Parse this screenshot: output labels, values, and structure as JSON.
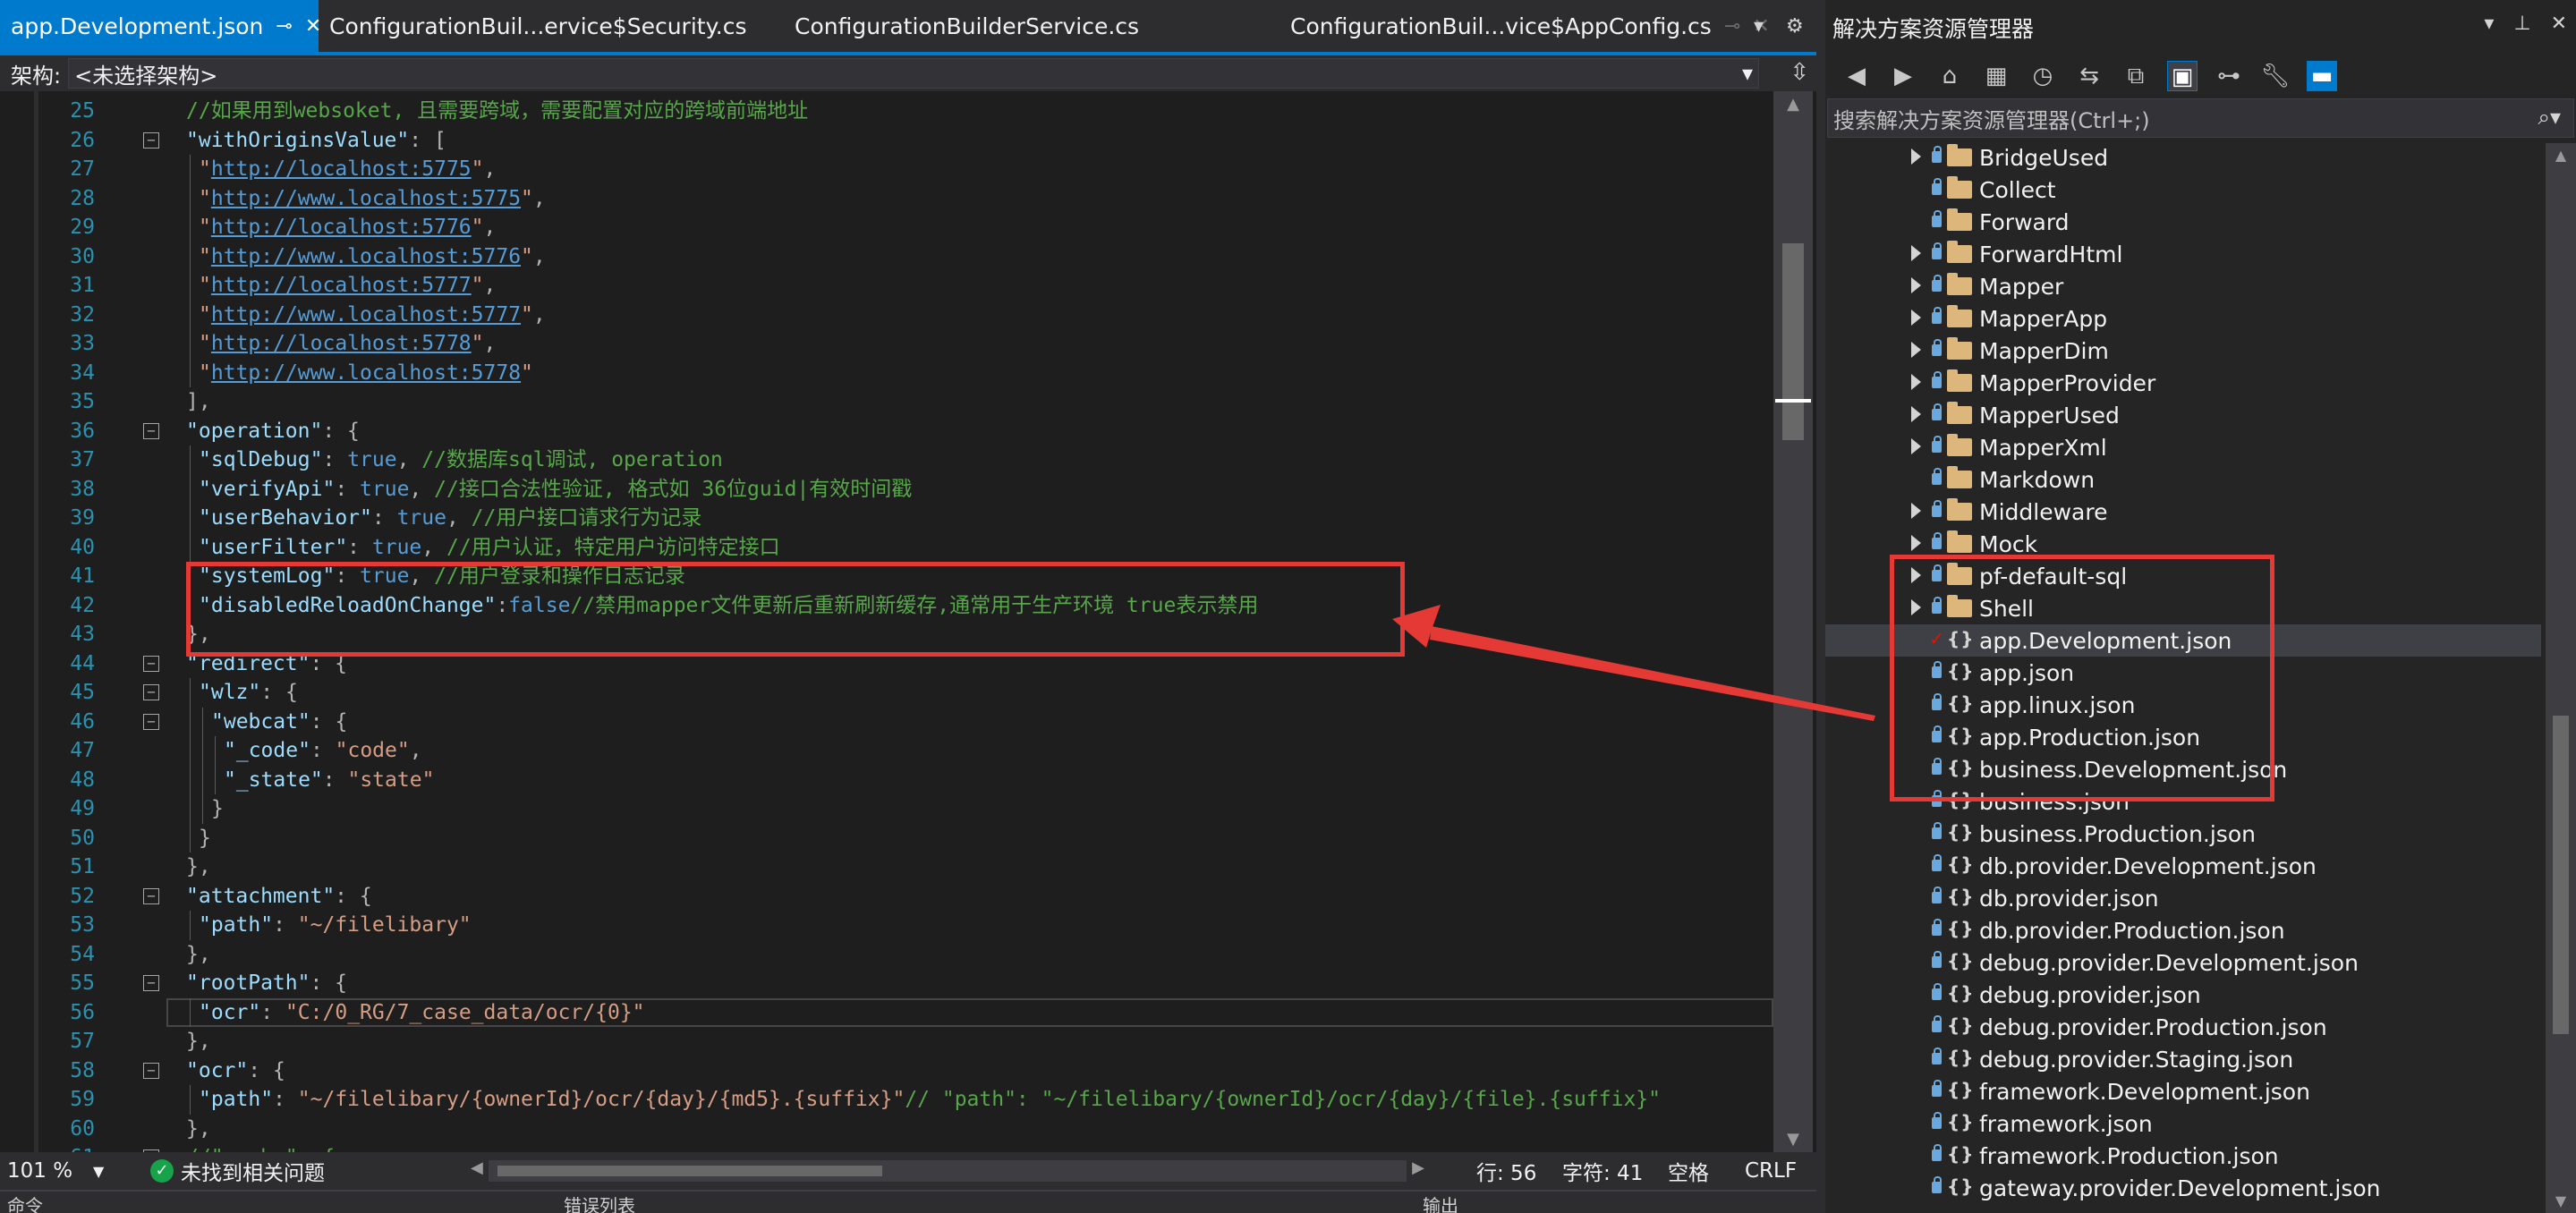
{
  "editor": {
    "tabs": [
      {
        "label": "app.Development.json",
        "active": true,
        "pin_icon": "pin-icon",
        "close_icon": "close-icon"
      },
      {
        "label": "ConfigurationBuil...ervice$Security.cs",
        "active": false
      },
      {
        "label": "ConfigurationBuilderService.cs",
        "active": false
      },
      {
        "label": "ConfigurationBuil...vice$AppConfig.cs",
        "active": false
      }
    ],
    "nav": {
      "label": "架构:",
      "value": "<未选择架构>"
    },
    "lines": [
      {
        "n": "25",
        "indent": 1,
        "html_parts": [
          {
            "c": "cm",
            "t": "//如果用到websoket, 且需要跨域，需要配置对应的跨域前端地址"
          }
        ]
      },
      {
        "n": "26",
        "indent": 1,
        "fold": "-",
        "html_parts": [
          {
            "c": "key",
            "t": "\"withOriginsValue\""
          },
          {
            "c": "p",
            "t": ": ["
          }
        ]
      },
      {
        "n": "27",
        "indent": 2,
        "html_parts": [
          {
            "c": "q",
            "t": "\""
          },
          {
            "c": "url",
            "t": "http://localhost:5775"
          },
          {
            "c": "q",
            "t": "\""
          },
          {
            "c": "p",
            "t": ","
          }
        ]
      },
      {
        "n": "28",
        "indent": 2,
        "html_parts": [
          {
            "c": "q",
            "t": "\""
          },
          {
            "c": "url",
            "t": "http://www.localhost:5775"
          },
          {
            "c": "q",
            "t": "\""
          },
          {
            "c": "p",
            "t": ","
          }
        ]
      },
      {
        "n": "29",
        "indent": 2,
        "html_parts": [
          {
            "c": "q",
            "t": "\""
          },
          {
            "c": "url",
            "t": "http://localhost:5776"
          },
          {
            "c": "q",
            "t": "\""
          },
          {
            "c": "p",
            "t": ","
          }
        ]
      },
      {
        "n": "30",
        "indent": 2,
        "html_parts": [
          {
            "c": "q",
            "t": "\""
          },
          {
            "c": "url",
            "t": "http://www.localhost:5776"
          },
          {
            "c": "q",
            "t": "\""
          },
          {
            "c": "p",
            "t": ","
          }
        ]
      },
      {
        "n": "31",
        "indent": 2,
        "html_parts": [
          {
            "c": "q",
            "t": "\""
          },
          {
            "c": "url",
            "t": "http://localhost:5777"
          },
          {
            "c": "q",
            "t": "\""
          },
          {
            "c": "p",
            "t": ","
          }
        ]
      },
      {
        "n": "32",
        "indent": 2,
        "html_parts": [
          {
            "c": "q",
            "t": "\""
          },
          {
            "c": "url",
            "t": "http://www.localhost:5777"
          },
          {
            "c": "q",
            "t": "\""
          },
          {
            "c": "p",
            "t": ","
          }
        ]
      },
      {
        "n": "33",
        "indent": 2,
        "html_parts": [
          {
            "c": "q",
            "t": "\""
          },
          {
            "c": "url",
            "t": "http://localhost:5778"
          },
          {
            "c": "q",
            "t": "\""
          },
          {
            "c": "p",
            "t": ","
          }
        ]
      },
      {
        "n": "34",
        "indent": 2,
        "html_parts": [
          {
            "c": "q",
            "t": "\""
          },
          {
            "c": "url",
            "t": "http://www.localhost:5778"
          },
          {
            "c": "q",
            "t": "\""
          }
        ]
      },
      {
        "n": "35",
        "indent": 1,
        "html_parts": [
          {
            "c": "p",
            "t": "],"
          }
        ]
      },
      {
        "n": "36",
        "indent": 1,
        "fold": "-",
        "html_parts": [
          {
            "c": "key",
            "t": "\"operation\""
          },
          {
            "c": "p",
            "t": ": {"
          }
        ]
      },
      {
        "n": "37",
        "indent": 2,
        "html_parts": [
          {
            "c": "key",
            "t": "\"sqlDebug\""
          },
          {
            "c": "p",
            "t": ": "
          },
          {
            "c": "kw",
            "t": "true"
          },
          {
            "c": "p",
            "t": ", "
          },
          {
            "c": "cm",
            "t": "//数据库sql调试, operation"
          }
        ]
      },
      {
        "n": "38",
        "indent": 2,
        "html_parts": [
          {
            "c": "key",
            "t": "\"verifyApi\""
          },
          {
            "c": "p",
            "t": ": "
          },
          {
            "c": "kw",
            "t": "true"
          },
          {
            "c": "p",
            "t": ", "
          },
          {
            "c": "cm",
            "t": "//接口合法性验证, 格式如 36位guid|有效时间戳"
          }
        ]
      },
      {
        "n": "39",
        "indent": 2,
        "html_parts": [
          {
            "c": "key",
            "t": "\"userBehavior\""
          },
          {
            "c": "p",
            "t": ": "
          },
          {
            "c": "kw",
            "t": "true"
          },
          {
            "c": "p",
            "t": ", "
          },
          {
            "c": "cm",
            "t": "//用户接口请求行为记录"
          }
        ]
      },
      {
        "n": "40",
        "indent": 2,
        "html_parts": [
          {
            "c": "key",
            "t": "\"userFilter\""
          },
          {
            "c": "p",
            "t": ": "
          },
          {
            "c": "kw",
            "t": "true"
          },
          {
            "c": "p",
            "t": ", "
          },
          {
            "c": "cm",
            "t": "//用户认证，特定用户访问特定接口"
          }
        ]
      },
      {
        "n": "41",
        "indent": 2,
        "html_parts": [
          {
            "c": "key",
            "t": "\"systemLog\""
          },
          {
            "c": "p",
            "t": ": "
          },
          {
            "c": "kw",
            "t": "true"
          },
          {
            "c": "p",
            "t": ", "
          },
          {
            "c": "cm",
            "t": "//用户登录和操作日志记录"
          }
        ]
      },
      {
        "n": "42",
        "indent": 2,
        "html_parts": [
          {
            "c": "key",
            "t": "\"disabledReloadOnChange\""
          },
          {
            "c": "p",
            "t": ":"
          },
          {
            "c": "kw",
            "t": "false"
          },
          {
            "c": "cm",
            "t": "//禁用mapper文件更新后重新刷新缓存,通常用于生产环境 true表示禁用"
          }
        ]
      },
      {
        "n": "43",
        "indent": 1,
        "html_parts": [
          {
            "c": "p",
            "t": "},"
          }
        ]
      },
      {
        "n": "44",
        "indent": 1,
        "fold": "-",
        "html_parts": [
          {
            "c": "key",
            "t": "\"redirect\""
          },
          {
            "c": "p",
            "t": ": {"
          }
        ]
      },
      {
        "n": "45",
        "indent": 2,
        "fold": "-",
        "html_parts": [
          {
            "c": "key",
            "t": "\"wlz\""
          },
          {
            "c": "p",
            "t": ": {"
          }
        ]
      },
      {
        "n": "46",
        "indent": 3,
        "fold": "-",
        "html_parts": [
          {
            "c": "key",
            "t": "\"webcat\""
          },
          {
            "c": "p",
            "t": ": {"
          }
        ]
      },
      {
        "n": "47",
        "indent": 4,
        "html_parts": [
          {
            "c": "key",
            "t": "\"_code\""
          },
          {
            "c": "p",
            "t": ": "
          },
          {
            "c": "str",
            "t": "\"code\""
          },
          {
            "c": "p",
            "t": ","
          }
        ]
      },
      {
        "n": "48",
        "indent": 4,
        "html_parts": [
          {
            "c": "key",
            "t": "\"_state\""
          },
          {
            "c": "p",
            "t": ": "
          },
          {
            "c": "str",
            "t": "\"state\""
          }
        ]
      },
      {
        "n": "49",
        "indent": 3,
        "html_parts": [
          {
            "c": "p",
            "t": "}"
          }
        ]
      },
      {
        "n": "50",
        "indent": 2,
        "html_parts": [
          {
            "c": "p",
            "t": "}"
          }
        ]
      },
      {
        "n": "51",
        "indent": 1,
        "html_parts": [
          {
            "c": "p",
            "t": "},"
          }
        ]
      },
      {
        "n": "52",
        "indent": 1,
        "fold": "-",
        "html_parts": [
          {
            "c": "key",
            "t": "\"attachment\""
          },
          {
            "c": "p",
            "t": ": {"
          }
        ]
      },
      {
        "n": "53",
        "indent": 2,
        "html_parts": [
          {
            "c": "key",
            "t": "\"path\""
          },
          {
            "c": "p",
            "t": ": "
          },
          {
            "c": "str",
            "t": "\"~/filelibary\""
          }
        ]
      },
      {
        "n": "54",
        "indent": 1,
        "html_parts": [
          {
            "c": "p",
            "t": "},"
          }
        ]
      },
      {
        "n": "55",
        "indent": 1,
        "fold": "-",
        "html_parts": [
          {
            "c": "key",
            "t": "\"rootPath\""
          },
          {
            "c": "p",
            "t": ": {"
          }
        ]
      },
      {
        "n": "56",
        "indent": 2,
        "current": true,
        "html_parts": [
          {
            "c": "key",
            "t": "\"ocr\""
          },
          {
            "c": "p",
            "t": ": "
          },
          {
            "c": "str",
            "t": "\"C:/0_RG/7_case_data/ocr/{0}\""
          }
        ]
      },
      {
        "n": "57",
        "indent": 1,
        "html_parts": [
          {
            "c": "p",
            "t": "},"
          }
        ]
      },
      {
        "n": "58",
        "indent": 1,
        "fold": "-",
        "html_parts": [
          {
            "c": "key",
            "t": "\"ocr\""
          },
          {
            "c": "p",
            "t": ": {"
          }
        ]
      },
      {
        "n": "59",
        "indent": 2,
        "html_parts": [
          {
            "c": "key",
            "t": "\"path\""
          },
          {
            "c": "p",
            "t": ": "
          },
          {
            "c": "str",
            "t": "\"~/filelibary/{ownerId}/ocr/{day}/{md5}.{suffix}\""
          },
          {
            "c": "cm",
            "t": "// \"path\": \"~/filelibary/{ownerId}/ocr/{day}/{file}.{suffix}\""
          }
        ]
      },
      {
        "n": "60",
        "indent": 1,
        "html_parts": [
          {
            "c": "p",
            "t": "},"
          }
        ]
      },
      {
        "n": "61",
        "indent": 1,
        "fold": "-",
        "html_parts": [
          {
            "c": "cm",
            "t": "//\"cache\": {"
          }
        ]
      }
    ],
    "status": {
      "zoom": "101 %",
      "issues": "未找到相关问题",
      "line": "行: 56",
      "char": "字符: 41",
      "whitespace": "空格",
      "eol": "CRLF"
    },
    "bottom_tabs": [
      "命令",
      "错误列表",
      "输出"
    ]
  },
  "solution_explorer": {
    "title": "解决方案资源管理器",
    "search_placeholder": "搜索解决方案资源管理器(Ctrl+;)",
    "items": [
      {
        "name": "BridgeUsed",
        "type": "folder",
        "expandable": true
      },
      {
        "name": "Collect",
        "type": "folder",
        "expandable": false
      },
      {
        "name": "Forward",
        "type": "folder",
        "expandable": false
      },
      {
        "name": "ForwardHtml",
        "type": "folder",
        "expandable": true
      },
      {
        "name": "Mapper",
        "type": "folder",
        "expandable": true
      },
      {
        "name": "MapperApp",
        "type": "folder",
        "expandable": true
      },
      {
        "name": "MapperDim",
        "type": "folder",
        "expandable": true
      },
      {
        "name": "MapperProvider",
        "type": "folder",
        "expandable": true
      },
      {
        "name": "MapperUsed",
        "type": "folder",
        "expandable": true
      },
      {
        "name": "MapperXml",
        "type": "folder",
        "expandable": true
      },
      {
        "name": "Markdown",
        "type": "folder",
        "expandable": false
      },
      {
        "name": "Middleware",
        "type": "folder",
        "expandable": true
      },
      {
        "name": "Mock",
        "type": "folder",
        "expandable": true
      },
      {
        "name": "pf-default-sql",
        "type": "folder",
        "expandable": true
      },
      {
        "name": "Shell",
        "type": "folder",
        "expandable": true
      },
      {
        "name": "app.Development.json",
        "type": "json",
        "selected": true,
        "checked": true
      },
      {
        "name": "app.json",
        "type": "json"
      },
      {
        "name": "app.linux.json",
        "type": "json"
      },
      {
        "name": "app.Production.json",
        "type": "json"
      },
      {
        "name": "business.Development.json",
        "type": "json"
      },
      {
        "name": "business.json",
        "type": "json"
      },
      {
        "name": "business.Production.json",
        "type": "json"
      },
      {
        "name": "db.provider.Development.json",
        "type": "json"
      },
      {
        "name": "db.provider.json",
        "type": "json"
      },
      {
        "name": "db.provider.Production.json",
        "type": "json"
      },
      {
        "name": "debug.provider.Development.json",
        "type": "json"
      },
      {
        "name": "debug.provider.json",
        "type": "json"
      },
      {
        "name": "debug.provider.Production.json",
        "type": "json"
      },
      {
        "name": "debug.provider.Staging.json",
        "type": "json"
      },
      {
        "name": "framework.Development.json",
        "type": "json"
      },
      {
        "name": "framework.json",
        "type": "json"
      },
      {
        "name": "framework.Production.json",
        "type": "json"
      },
      {
        "name": "gateway.provider.Development.json",
        "type": "json"
      }
    ]
  },
  "colors": {
    "accent": "#007acc",
    "annotation": "#e53935",
    "background": "#1e1e1e"
  }
}
